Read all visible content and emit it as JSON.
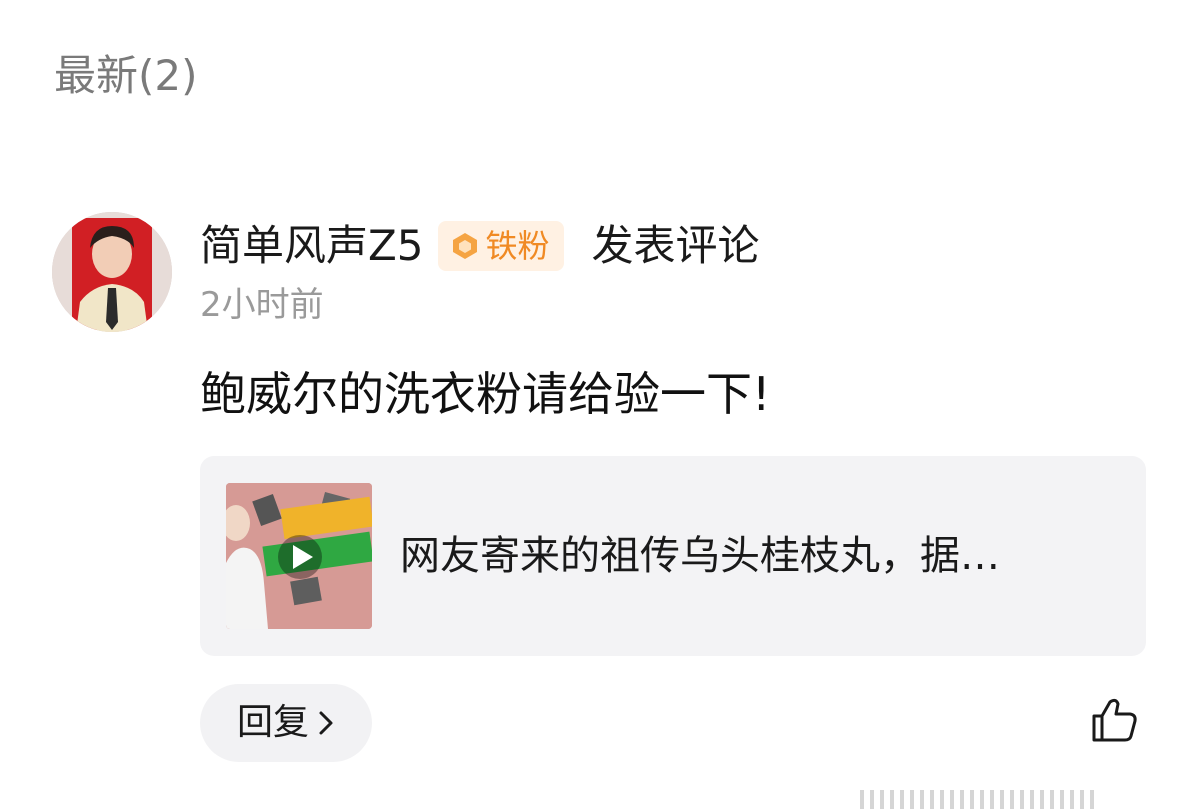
{
  "section": {
    "title": "最新(2)"
  },
  "comment": {
    "username": "简单风声Z5",
    "badge_label": "铁粉",
    "action": "发表评论",
    "time": "2小时前",
    "text": "鲍威尔的洗衣粉请给验一下!",
    "link_card": {
      "title": "网友寄来的祖传乌头桂枝丸，据…",
      "thumbnail_icon": "play-icon"
    },
    "reply_label": "回复",
    "like_icon": "thumbs-up-icon"
  },
  "colors": {
    "badge_accent": "#f08a24",
    "badge_bg": "#fff1e3",
    "card_bg": "#f3f3f5",
    "muted_text": "#9a9a9a",
    "section_title": "#7a7a7a"
  }
}
